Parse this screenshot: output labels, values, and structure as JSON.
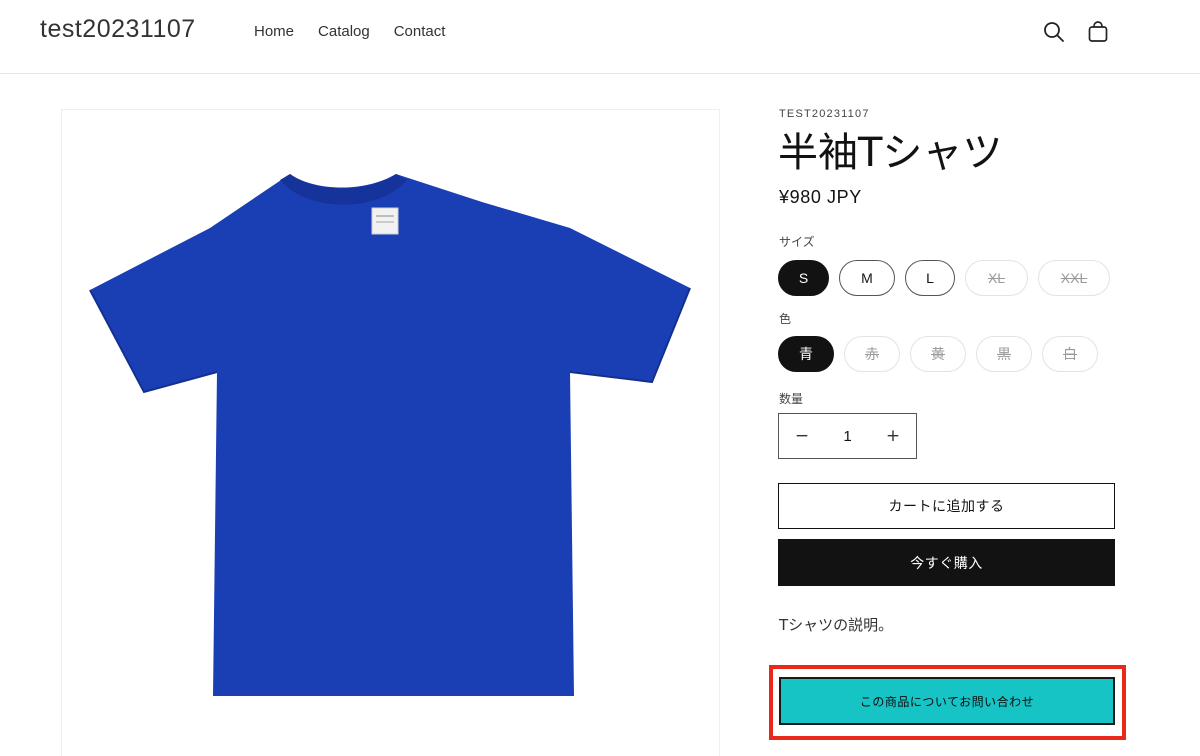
{
  "header": {
    "logo": "test20231107",
    "nav": [
      "Home",
      "Catalog",
      "Contact"
    ],
    "icons": [
      "search-icon",
      "cart-icon"
    ]
  },
  "product": {
    "vendor": "TEST20231107",
    "title": "半袖Tシャツ",
    "price": "¥980 JPY",
    "image_color": "#1a3fb5",
    "size": {
      "label": "サイズ",
      "options": [
        {
          "label": "S",
          "state": "selected"
        },
        {
          "label": "M",
          "state": "available"
        },
        {
          "label": "L",
          "state": "available"
        },
        {
          "label": "XL",
          "state": "unavailable"
        },
        {
          "label": "XXL",
          "state": "unavailable"
        }
      ]
    },
    "color": {
      "label": "色",
      "options": [
        {
          "label": "青",
          "state": "selected"
        },
        {
          "label": "赤",
          "state": "unavailable"
        },
        {
          "label": "黄",
          "state": "unavailable"
        },
        {
          "label": "黒",
          "state": "unavailable"
        },
        {
          "label": "白",
          "state": "unavailable"
        }
      ]
    },
    "quantity": {
      "label": "数量",
      "value": "1",
      "minus": "−",
      "plus": "+"
    },
    "add_to_cart": "カートに追加する",
    "buy_now": "今すぐ購入",
    "description": "Tシャツの説明。",
    "contact_button": "この商品についてお問い合わせ",
    "contact_button_color": "#16c4c6",
    "highlight_color": "#e8281a"
  }
}
